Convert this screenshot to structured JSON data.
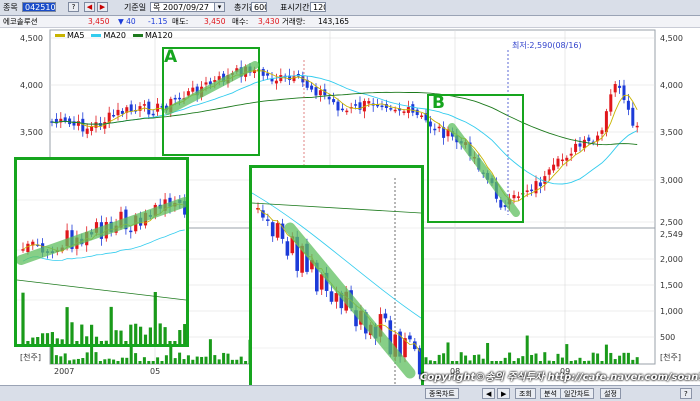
{
  "toolbar": {
    "code_label": "종목",
    "code_value": "042510",
    "question": "?",
    "date_label": "기준일",
    "date_value": "목 2007/09/27",
    "period_label": "총기간",
    "period_value": "600",
    "display_label": "표시기간",
    "display_value": "120"
  },
  "quote": {
    "name": "에코솔루션",
    "price": "3,450",
    "change": "▼ 40",
    "rate": "-1.15",
    "ask_label": "매도:",
    "ask": "3,450",
    "bid_label": "매수:",
    "bid": "3,430",
    "volume_label": "거래량:",
    "volume": "143,165"
  },
  "legend": [
    {
      "name": "MA5",
      "color": "#c8b400"
    },
    {
      "name": "MA20",
      "color": "#33ccee"
    },
    {
      "name": "MA120",
      "color": "#1d7a1d"
    }
  ],
  "annotations": {
    "label_a": "A",
    "label_b": "B",
    "low_note": "최저:2,590(08/16)"
  },
  "price_axis": [
    "4,500",
    "4,000",
    "3,500",
    "3,000",
    "2,500"
  ],
  "volume_axis": [
    "2,549",
    "2,000",
    "1,500",
    "1,000",
    "500",
    "[천주]"
  ],
  "volume_unit_left": "[천주]",
  "time_axis": [
    "2007",
    "05",
    "08",
    "09"
  ],
  "bottom_buttons": [
    "종목차트",
    "◀",
    "▶",
    "조회",
    "분석",
    "일간차트",
    "설정",
    "?"
  ],
  "credit": "Copyright©송의 주식투자 http://cafe.naver.com/soan7",
  "colors": {
    "up": "#e0161b",
    "down": "#1c3bd8",
    "highlight": "#16a51e",
    "volume": "#1a9a1a"
  }
}
